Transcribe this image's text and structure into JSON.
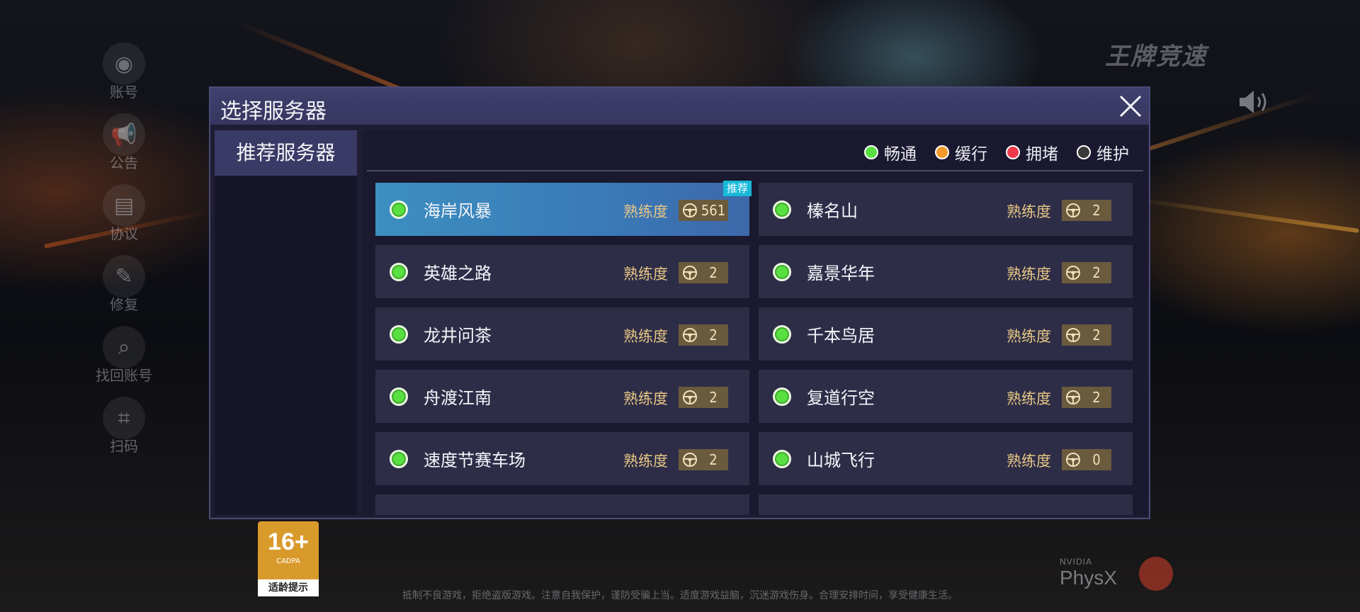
{
  "dialog": {
    "title": "选择服务器",
    "tab_label": "推荐服务器",
    "legend": [
      {
        "label": "畅通",
        "color": "#58e040"
      },
      {
        "label": "缓行",
        "color": "#f39a2b"
      },
      {
        "label": "拥堵",
        "color": "#f03a4a"
      },
      {
        "label": "维护",
        "color": "#3a3a3a"
      }
    ],
    "proficiency_label": "熟练度",
    "recommend_badge": "推荐",
    "servers": [
      {
        "name": "海岸风暴",
        "proficiency": "561",
        "selected": true
      },
      {
        "name": "榛名山",
        "proficiency": "2"
      },
      {
        "name": "英雄之路",
        "proficiency": "2"
      },
      {
        "name": "嘉景华年",
        "proficiency": "2"
      },
      {
        "name": "龙井问茶",
        "proficiency": "2"
      },
      {
        "name": "千本鸟居",
        "proficiency": "2"
      },
      {
        "name": "舟渡江南",
        "proficiency": "2"
      },
      {
        "name": "复道行空",
        "proficiency": "2"
      },
      {
        "name": "速度节赛车场",
        "proficiency": "2"
      },
      {
        "name": "山城飞行",
        "proficiency": "0"
      }
    ]
  },
  "side_menu": [
    "账号",
    "公告",
    "协议",
    "修复",
    "找回账号",
    "扫码"
  ],
  "brand": "王牌竞速",
  "footer": {
    "age_rating": "16+",
    "age_sub": "CADPA",
    "age_tip": "适龄提示",
    "bottom_notice": "抵制不良游戏，拒绝盗版游戏。注意自我保护，谨防受骗上当。适度游戏益脑，沉迷游戏伤身。合理安排时间，享受健康生活。"
  },
  "physx": {
    "vendor": "NVIDIA",
    "product": "PhysX"
  },
  "icons": {
    "close": "close-icon",
    "volume": "speaker-icon",
    "wheel": "steering-wheel-icon"
  }
}
